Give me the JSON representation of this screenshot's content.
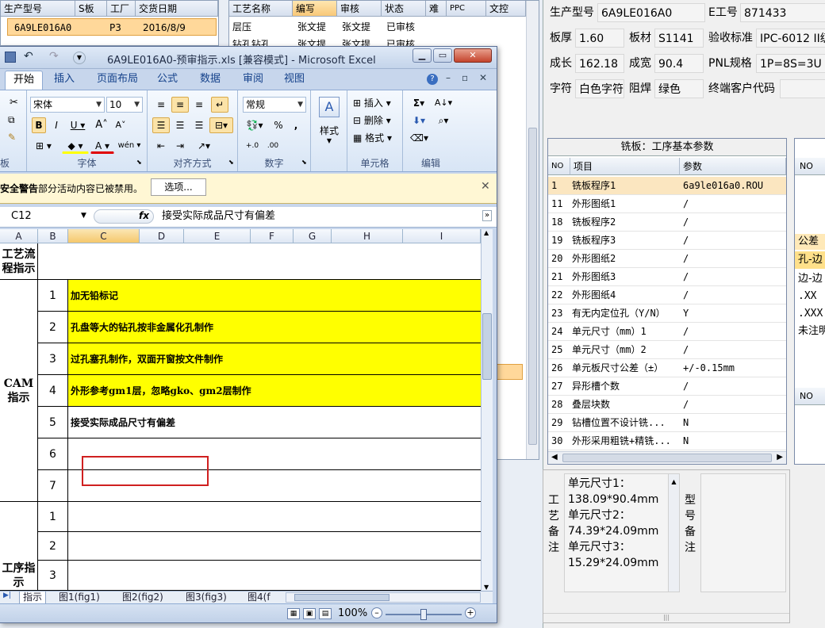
{
  "bg_left": {
    "headers": [
      "生产型号",
      "S板",
      "工厂",
      "交货日期"
    ],
    "row": [
      "6A9LE016A0",
      "P3",
      "2016/8/9"
    ]
  },
  "bg_middle": {
    "headers": [
      "工艺名称",
      "编写",
      "审核",
      "状态",
      "难",
      "PPC",
      "文控"
    ],
    "rows": [
      [
        "层压",
        "张文提",
        "张文提",
        "已审核"
      ],
      [
        "钻孔钻孔",
        "张文提",
        "张文提",
        "已审核"
      ]
    ]
  },
  "right_fields": {
    "model_label": "生产型号",
    "model_value": "6A9LE016A0",
    "e_label": "E工号",
    "e_value": "871433",
    "thick_label": "板厚",
    "thick_value": "1.60",
    "material_label": "板材",
    "material_value": "S1141",
    "std_label": "验收标准",
    "std_value": "IPC-6012 II级",
    "len_label": "成长",
    "len_value": "162.18",
    "wid_label": "成宽",
    "wid_value": "90.4",
    "pnl_label": "PNL规格",
    "pnl_value": "1P=8S=3U",
    "char_label": "字符",
    "char_value": "白色字符",
    "mask_label": "阻焊",
    "mask_value": "绿色",
    "cust_label": "终端客户代码",
    "cust_value": ""
  },
  "param_panel": {
    "title": "铣板：工序基本参数",
    "col_no": "NO",
    "col_item": "项目",
    "col_param": "参数",
    "rows": [
      {
        "no": "1",
        "item": "铣板程序1",
        "param": "6a9le016a0.ROU"
      },
      {
        "no": "11",
        "item": "外形图纸1",
        "param": "/"
      },
      {
        "no": "18",
        "item": "铣板程序2",
        "param": "/"
      },
      {
        "no": "19",
        "item": "铣板程序3",
        "param": "/"
      },
      {
        "no": "20",
        "item": "外形图纸2",
        "param": "/"
      },
      {
        "no": "21",
        "item": "外形图纸3",
        "param": "/"
      },
      {
        "no": "22",
        "item": "外形图纸4",
        "param": "/"
      },
      {
        "no": "23",
        "item": "有无内定位孔（Y/N）",
        "param": "Y"
      },
      {
        "no": "24",
        "item": "单元尺寸（mm）1",
        "param": "/"
      },
      {
        "no": "25",
        "item": "单元尺寸（mm）2",
        "param": "/"
      },
      {
        "no": "26",
        "item": "单元板尺寸公差（±）",
        "param": "+/-0.15mm"
      },
      {
        "no": "27",
        "item": "异形槽个数",
        "param": "/"
      },
      {
        "no": "28",
        "item": "叠层块数",
        "param": "/"
      },
      {
        "no": "29",
        "item": "钻槽位置不设计铣...",
        "param": "N"
      },
      {
        "no": "30",
        "item": "外形采用粗铣+精铣...",
        "param": "N"
      }
    ]
  },
  "far_right": {
    "no": "NO",
    "gongcha": "公差",
    "r1": "孔-边",
    "r2": "边-边",
    "r3": ".XX",
    "r4": ".XXX",
    "r5": "未注明",
    "no2": "NO"
  },
  "notes": {
    "craft_label": "工艺备注",
    "lines": [
      "单元尺寸1：",
      "138.09*90.4mm",
      "单元尺寸2：",
      "74.39*24.09mm",
      "单元尺寸3：",
      "15.29*24.09mm"
    ],
    "model_label": "型号备注"
  },
  "excel": {
    "title": "6A9LE016A0-预审指示.xls  [兼容模式] - Microsoft Excel",
    "tabs": [
      "开始",
      "插入",
      "页面布局",
      "公式",
      "数据",
      "审阅",
      "视图"
    ],
    "font_name": "宋体",
    "font_size": "10",
    "number_format": "常规",
    "groups": [
      "字体",
      "对齐方式",
      "数字",
      "样式",
      "单元格",
      "编辑"
    ],
    "cell_btns": [
      "插入",
      "删除",
      "格式"
    ],
    "style_btn": "样式",
    "security_title": "安全警告",
    "security_text": "部分活动内容已被禁用。",
    "options_btn": "选项...",
    "name_box": "C12",
    "formula": "接受实际成品尺寸有偏差",
    "columns": [
      "A",
      "B",
      "C",
      "D",
      "E",
      "F",
      "G",
      "H",
      "I"
    ],
    "section1": "工艺流程指示",
    "section2": "CAM指示",
    "section3": "工序指示",
    "rows": [
      {
        "num": "1",
        "text": "加无铅标记"
      },
      {
        "num": "2",
        "text": "孔盘等大的钻孔按非金属化孔制作"
      },
      {
        "num": "3",
        "text": "过孔塞孔制作，双面开窗按文件制作"
      },
      {
        "num": "4",
        "text": "外形参考gm1层，忽略gko、gm2层制作"
      },
      {
        "num": "5",
        "text": "接受实际成品尺寸有偏差"
      },
      {
        "num": "6",
        "text": ""
      },
      {
        "num": "7",
        "text": ""
      },
      {
        "num": "1",
        "text": ""
      },
      {
        "num": "2",
        "text": ""
      },
      {
        "num": "3",
        "text": ""
      }
    ],
    "sheet_tabs": [
      "指示",
      "图1(fig1)",
      "图2(fig2)",
      "图3(fig3)",
      "图4(f"
    ],
    "zoom": "100%"
  }
}
